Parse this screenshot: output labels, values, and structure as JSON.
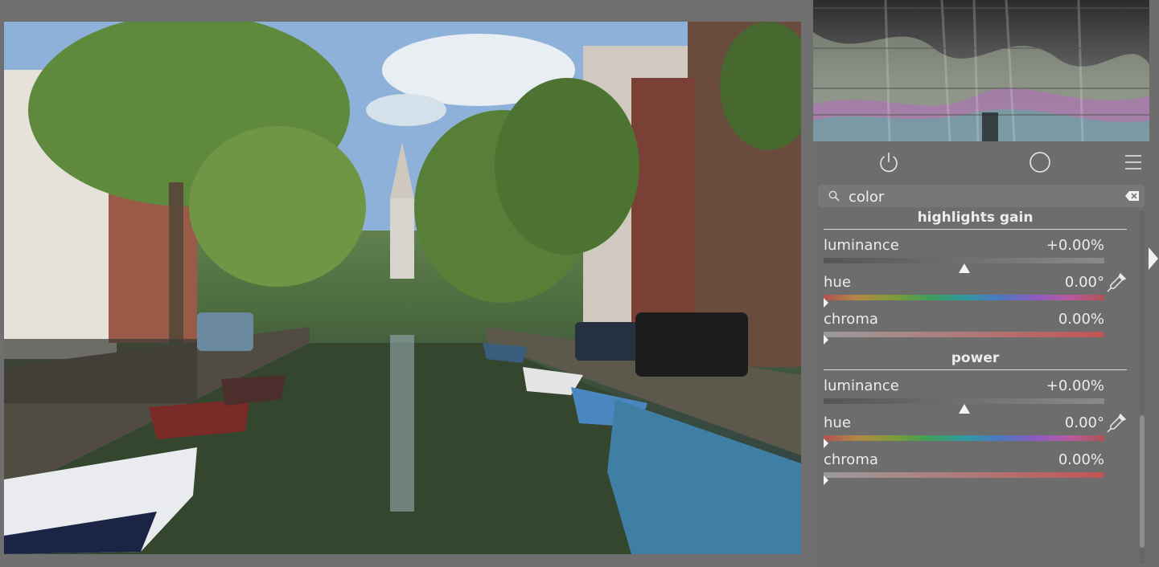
{
  "search": {
    "value": "color"
  },
  "sections": [
    {
      "title": "highlights gain",
      "sliders": [
        {
          "label": "luminance",
          "value": "+0.00%",
          "kind": "gray",
          "position": 0.5
        },
        {
          "label": "hue",
          "value": "0.00°",
          "kind": "hue",
          "position": 0.0
        },
        {
          "label": "chroma",
          "value": "0.00%",
          "kind": "chroma",
          "position": 0.0
        }
      ]
    },
    {
      "title": "power",
      "sliders": [
        {
          "label": "luminance",
          "value": "+0.00%",
          "kind": "gray",
          "position": 0.5
        },
        {
          "label": "hue",
          "value": "0.00°",
          "kind": "hue",
          "position": 0.0
        },
        {
          "label": "chroma",
          "value": "0.00%",
          "kind": "chroma",
          "position": 0.0
        }
      ]
    }
  ],
  "icons": {
    "power": "power-icon",
    "reset": "reset-circle-icon",
    "presets": "presets-menu-icon",
    "search": "search-icon",
    "clear": "clear-search-icon",
    "picker": "color-picker-icon",
    "expand": "expand-panel-icon"
  },
  "colors": {
    "background": "#6f6f6f",
    "panel": "#6d6d6d",
    "histogram_bg": "#2b2b2b"
  }
}
